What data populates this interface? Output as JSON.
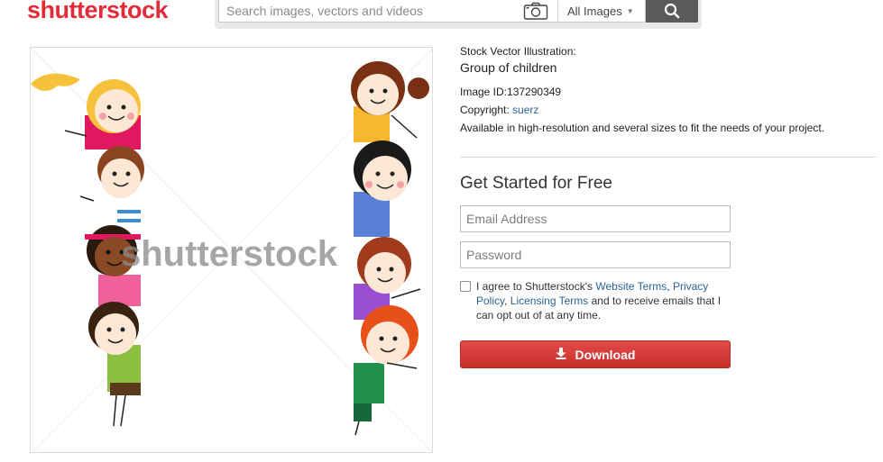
{
  "header": {
    "logo_text": "shutterstock",
    "search_placeholder": "Search images, vectors and videos",
    "filter_label": "All Images",
    "filter_caret": "▼"
  },
  "preview": {
    "watermark_text": "shutterstock"
  },
  "info": {
    "kind": "Stock Vector Illustration:",
    "title": "Group of children",
    "image_id": "Image ID:137290349",
    "copyright_label": "Copyright: ",
    "copyright_author": "suerz",
    "availability": "Available in high-resolution and several sizes to fit the needs of your project."
  },
  "signup": {
    "title": "Get Started for Free",
    "email_placeholder": "Email Address",
    "password_placeholder": "Password",
    "agree_prefix": "I agree to Shutterstock's ",
    "website_terms": "Website Terms",
    "comma": ", ",
    "privacy_policy": "Privacy Policy",
    "licensing_terms": "Licensing Terms",
    "agree_suffix": " and to receive emails that I can opt out of at any time.",
    "download_label": "Download"
  },
  "colors": {
    "brand_red": "#e22c38",
    "button_red": "#c9302c",
    "link_blue": "#2a6496"
  }
}
